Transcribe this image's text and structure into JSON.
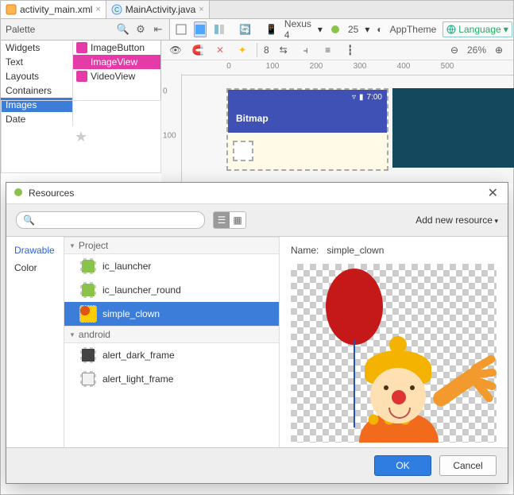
{
  "tabs": [
    {
      "label": "activity_main.xml",
      "active": true,
      "icon": "xml"
    },
    {
      "label": "MainActivity.java",
      "active": false,
      "icon": "java"
    }
  ],
  "palette": {
    "title": "Palette",
    "categories": [
      "Widgets",
      "Text",
      "Layouts",
      "Containers",
      "Images",
      "Date"
    ],
    "selected_category": "Images",
    "items": [
      "ImageButton",
      "ImageView",
      "VideoView"
    ],
    "selected_item": "ImageView"
  },
  "toolbar": {
    "device": "Nexus 4",
    "api": "25",
    "theme": "AppTheme",
    "language": "Language",
    "warnings": "8",
    "zoom": "26%"
  },
  "ruler_h": [
    "0",
    "100",
    "200",
    "300",
    "400",
    "500"
  ],
  "ruler_v": [
    "0",
    "100"
  ],
  "device": {
    "time": "7:00",
    "app_title": "Bitmap"
  },
  "dialog": {
    "title": "Resources",
    "search_placeholder": "",
    "add_new": "Add new resource",
    "categories": [
      "Drawable",
      "Color"
    ],
    "selected_category": "Drawable",
    "groups": [
      {
        "name": "Project",
        "items": [
          {
            "name": "ic_launcher",
            "thumb": "android"
          },
          {
            "name": "ic_launcher_round",
            "thumb": "android"
          },
          {
            "name": "simple_clown",
            "thumb": "clown",
            "selected": true
          }
        ]
      },
      {
        "name": "android",
        "items": [
          {
            "name": "alert_dark_frame",
            "thumb": "dark"
          },
          {
            "name": "alert_light_frame",
            "thumb": "light"
          }
        ]
      }
    ],
    "preview_label": "Name:",
    "preview_name": "simple_clown",
    "ok": "OK",
    "cancel": "Cancel"
  }
}
